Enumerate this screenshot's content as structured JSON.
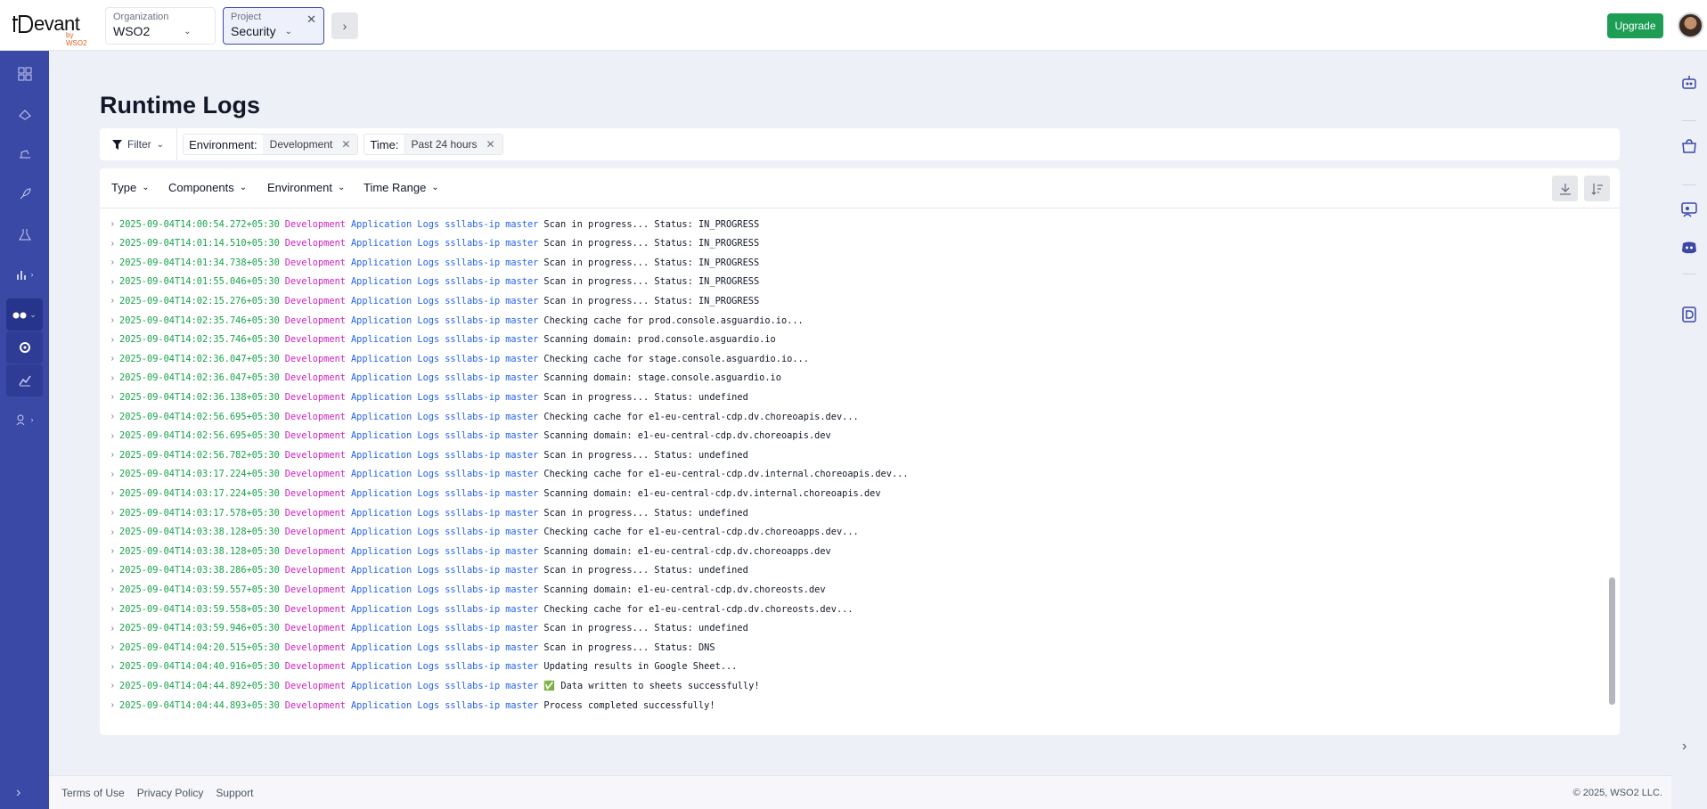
{
  "app": {
    "logo_text": "evant",
    "logo_sub": "by WSO2"
  },
  "header": {
    "org_label": "Organization",
    "org_value": "WSO2",
    "project_label": "Project",
    "project_value": "Security",
    "upgrade_label": "Upgrade"
  },
  "sidebar": {
    "items": [
      {
        "icon": "overview-icon"
      },
      {
        "icon": "components-icon"
      },
      {
        "icon": "deploy-icon"
      },
      {
        "icon": "rocket-icon"
      },
      {
        "icon": "test-icon"
      },
      {
        "icon": "insights-icon",
        "has_chevron": true
      },
      {
        "icon": "observability-icon",
        "has_chevron": true,
        "active": true
      },
      {
        "icon": "runtime-logs-icon",
        "sub": true
      },
      {
        "icon": "metrics-icon",
        "sub": true
      },
      {
        "icon": "admin-icon",
        "has_chevron": true
      }
    ]
  },
  "page": {
    "title": "Runtime Logs"
  },
  "filters": {
    "filter_label": "Filter",
    "chips": [
      {
        "key": "Environment:",
        "value": "Development"
      },
      {
        "key": "Time:",
        "value": "Past 24 hours"
      }
    ]
  },
  "log_toolbar": {
    "dropdowns": [
      "Type",
      "Components",
      "Environment",
      "Time Range"
    ],
    "download_icon": "download-icon",
    "sort_icon": "sort-icon"
  },
  "logs": [
    {
      "ts": "2025-09-04T14:00:54.272+05:30",
      "env": "Development",
      "source": "Application Logs",
      "component": "ssllabs-ip",
      "branch": "master",
      "msg": "Scan in progress... Status: IN_PROGRESS"
    },
    {
      "ts": "2025-09-04T14:01:14.510+05:30",
      "env": "Development",
      "source": "Application Logs",
      "component": "ssllabs-ip",
      "branch": "master",
      "msg": "Scan in progress... Status: IN_PROGRESS"
    },
    {
      "ts": "2025-09-04T14:01:34.738+05:30",
      "env": "Development",
      "source": "Application Logs",
      "component": "ssllabs-ip",
      "branch": "master",
      "msg": "Scan in progress... Status: IN_PROGRESS"
    },
    {
      "ts": "2025-09-04T14:01:55.046+05:30",
      "env": "Development",
      "source": "Application Logs",
      "component": "ssllabs-ip",
      "branch": "master",
      "msg": "Scan in progress... Status: IN_PROGRESS"
    },
    {
      "ts": "2025-09-04T14:02:15.276+05:30",
      "env": "Development",
      "source": "Application Logs",
      "component": "ssllabs-ip",
      "branch": "master",
      "msg": "Scan in progress... Status: IN_PROGRESS"
    },
    {
      "ts": "2025-09-04T14:02:35.746+05:30",
      "env": "Development",
      "source": "Application Logs",
      "component": "ssllabs-ip",
      "branch": "master",
      "msg": "Checking cache for prod.console.asguardio.io..."
    },
    {
      "ts": "2025-09-04T14:02:35.746+05:30",
      "env": "Development",
      "source": "Application Logs",
      "component": "ssllabs-ip",
      "branch": "master",
      "msg": "Scanning domain: prod.console.asguardio.io"
    },
    {
      "ts": "2025-09-04T14:02:36.047+05:30",
      "env": "Development",
      "source": "Application Logs",
      "component": "ssllabs-ip",
      "branch": "master",
      "msg": "Checking cache for stage.console.asguardio.io..."
    },
    {
      "ts": "2025-09-04T14:02:36.047+05:30",
      "env": "Development",
      "source": "Application Logs",
      "component": "ssllabs-ip",
      "branch": "master",
      "msg": "Scanning domain: stage.console.asguardio.io"
    },
    {
      "ts": "2025-09-04T14:02:36.138+05:30",
      "env": "Development",
      "source": "Application Logs",
      "component": "ssllabs-ip",
      "branch": "master",
      "msg": "Scan in progress... Status: undefined"
    },
    {
      "ts": "2025-09-04T14:02:56.695+05:30",
      "env": "Development",
      "source": "Application Logs",
      "component": "ssllabs-ip",
      "branch": "master",
      "msg": "Checking cache for e1-eu-central-cdp.dv.choreoapis.dev..."
    },
    {
      "ts": "2025-09-04T14:02:56.695+05:30",
      "env": "Development",
      "source": "Application Logs",
      "component": "ssllabs-ip",
      "branch": "master",
      "msg": "Scanning domain: e1-eu-central-cdp.dv.choreoapis.dev"
    },
    {
      "ts": "2025-09-04T14:02:56.782+05:30",
      "env": "Development",
      "source": "Application Logs",
      "component": "ssllabs-ip",
      "branch": "master",
      "msg": "Scan in progress... Status: undefined"
    },
    {
      "ts": "2025-09-04T14:03:17.224+05:30",
      "env": "Development",
      "source": "Application Logs",
      "component": "ssllabs-ip",
      "branch": "master",
      "msg": "Checking cache for e1-eu-central-cdp.dv.internal.choreoapis.dev..."
    },
    {
      "ts": "2025-09-04T14:03:17.224+05:30",
      "env": "Development",
      "source": "Application Logs",
      "component": "ssllabs-ip",
      "branch": "master",
      "msg": "Scanning domain: e1-eu-central-cdp.dv.internal.choreoapis.dev"
    },
    {
      "ts": "2025-09-04T14:03:17.578+05:30",
      "env": "Development",
      "source": "Application Logs",
      "component": "ssllabs-ip",
      "branch": "master",
      "msg": "Scan in progress... Status: undefined"
    },
    {
      "ts": "2025-09-04T14:03:38.128+05:30",
      "env": "Development",
      "source": "Application Logs",
      "component": "ssllabs-ip",
      "branch": "master",
      "msg": "Checking cache for e1-eu-central-cdp.dv.choreoapps.dev..."
    },
    {
      "ts": "2025-09-04T14:03:38.128+05:30",
      "env": "Development",
      "source": "Application Logs",
      "component": "ssllabs-ip",
      "branch": "master",
      "msg": "Scanning domain: e1-eu-central-cdp.dv.choreoapps.dev"
    },
    {
      "ts": "2025-09-04T14:03:38.286+05:30",
      "env": "Development",
      "source": "Application Logs",
      "component": "ssllabs-ip",
      "branch": "master",
      "msg": "Scan in progress... Status: undefined"
    },
    {
      "ts": "2025-09-04T14:03:59.557+05:30",
      "env": "Development",
      "source": "Application Logs",
      "component": "ssllabs-ip",
      "branch": "master",
      "msg": "Scanning domain: e1-eu-central-cdp.dv.choreosts.dev"
    },
    {
      "ts": "2025-09-04T14:03:59.558+05:30",
      "env": "Development",
      "source": "Application Logs",
      "component": "ssllabs-ip",
      "branch": "master",
      "msg": "Checking cache for e1-eu-central-cdp.dv.choreosts.dev..."
    },
    {
      "ts": "2025-09-04T14:03:59.946+05:30",
      "env": "Development",
      "source": "Application Logs",
      "component": "ssllabs-ip",
      "branch": "master",
      "msg": "Scan in progress... Status: undefined"
    },
    {
      "ts": "2025-09-04T14:04:20.515+05:30",
      "env": "Development",
      "source": "Application Logs",
      "component": "ssllabs-ip",
      "branch": "master",
      "msg": "Scan in progress... Status: DNS"
    },
    {
      "ts": "2025-09-04T14:04:40.916+05:30",
      "env": "Development",
      "source": "Application Logs",
      "component": "ssllabs-ip",
      "branch": "master",
      "msg": "Updating results in Google Sheet..."
    },
    {
      "ts": "2025-09-04T14:04:44.892+05:30",
      "env": "Development",
      "source": "Application Logs",
      "component": "ssllabs-ip",
      "branch": "master",
      "msg": "✅ Data written to sheets successfully!"
    },
    {
      "ts": "2025-09-04T14:04:44.893+05:30",
      "env": "Development",
      "source": "Application Logs",
      "component": "ssllabs-ip",
      "branch": "master",
      "msg": "Process completed successfully!"
    }
  ],
  "footer": {
    "links": [
      "Terms of Use",
      "Privacy Policy",
      "Support"
    ],
    "copyright": "© 2025, WSO2 LLC."
  },
  "colors": {
    "sidebar": "#3a48a6",
    "upgrade": "#1e9e55",
    "timestamp": "#16a34a",
    "environment": "#d020c0",
    "source": "#2563eb"
  }
}
